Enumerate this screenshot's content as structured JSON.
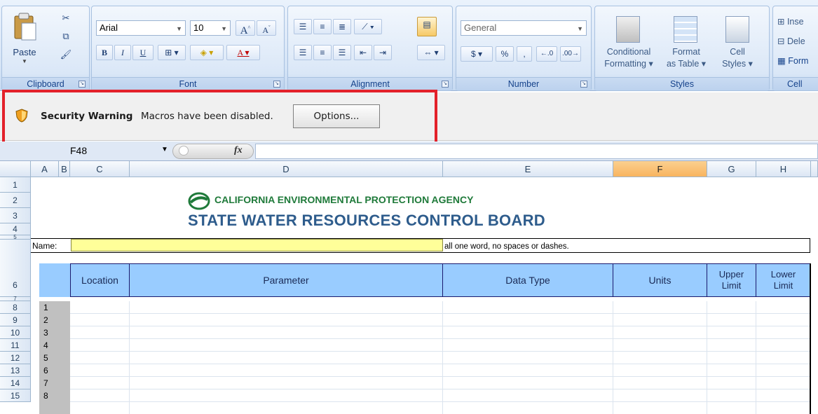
{
  "ribbon": {
    "clipboard": {
      "label": "Clipboard",
      "paste_label": "Paste"
    },
    "font": {
      "label": "Font",
      "font_name": "Arial",
      "font_size": "10",
      "bold": "B",
      "italic": "I",
      "underline": "U"
    },
    "alignment": {
      "label": "Alignment"
    },
    "number": {
      "label": "Number",
      "format": "General",
      "currency": "$",
      "percent": "%",
      "comma": ","
    },
    "styles": {
      "label": "Styles",
      "conditional_1": "Conditional",
      "conditional_2": "Formatting",
      "format_table_1": "Format",
      "format_table_2": "as Table",
      "cell_styles_1": "Cell",
      "cell_styles_2": "Styles"
    },
    "cells": {
      "label": "Cell",
      "insert": "Inse",
      "delete": "Dele",
      "format": "Form"
    }
  },
  "security_bar": {
    "title": "Security Warning",
    "message": "Macros have been disabled.",
    "options_label": "Options..."
  },
  "formula_bar": {
    "name_box": "F48",
    "fx_label": "fx",
    "formula": ""
  },
  "columns": [
    "A",
    "B",
    "C",
    "D",
    "E",
    "F",
    "G",
    "H"
  ],
  "rows": [
    "1",
    "2",
    "3",
    "4",
    "5",
    "6",
    "7",
    "8",
    "9",
    "10",
    "11",
    "12",
    "13",
    "14",
    "15"
  ],
  "sheet": {
    "agency": "CALIFORNIA ENVIRONMENTAL PROTECTION AGENCY",
    "board": "STATE WATER RESOURCES CONTROL BOARD",
    "name_label": "Name:",
    "name_value": "",
    "name_hint": "all one word, no spaces or dashes.",
    "headers": [
      "Location",
      "Parameter",
      "Data Type",
      "Units",
      "Upper Limit",
      "Lower Limit"
    ],
    "item_numbers": [
      "1",
      "2",
      "3",
      "4",
      "5",
      "6",
      "7",
      "8"
    ]
  },
  "colors": {
    "accent": "#99ccff",
    "warning_box": "#e3212a",
    "name_fill": "#ffff99",
    "selected_col": "#f8b45f"
  }
}
